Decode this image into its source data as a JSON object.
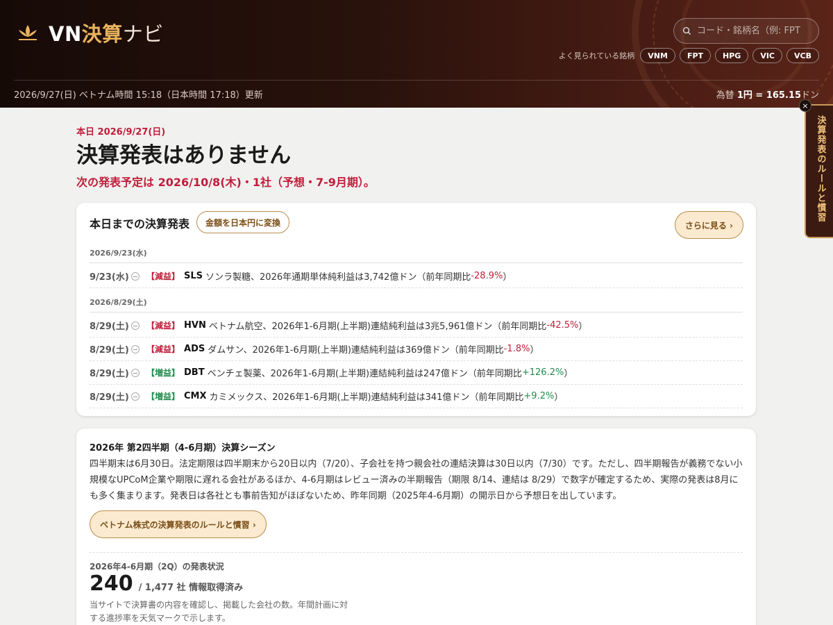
{
  "header": {
    "logo_vn": "VN",
    "logo_accent": "決算",
    "logo_kana": "ナビ",
    "search_placeholder": "コード・銘柄名（例: FPT",
    "popular_label": "よく見られている銘柄",
    "popular": [
      "VNM",
      "FPT",
      "HPG",
      "VIC",
      "VCB"
    ],
    "updated": "2026/9/27(日) ベトナム時間 15:18（日本時間 17:18）更新",
    "fx_prefix": "為替",
    "fx_value": "1円 = 165.15",
    "fx_unit": "ドン"
  },
  "sidetab": {
    "label": "決算発表のルールと慣習",
    "close": "×"
  },
  "main": {
    "today": "本日 2026/9/27(日)",
    "title": "決算発表はありません",
    "next": "次の発表予定は 2026/10/8(木)・1社（予想・7-9月期）。"
  },
  "recent": {
    "title": "本日までの決算発表",
    "convert_button": "金額を日本円に変換",
    "more_button": "さらに見る ›",
    "groups": [
      {
        "date": "2026/9/23(水)",
        "rows": [
          {
            "d": "9/23(水)",
            "tag": "【減益】",
            "code": "SLS",
            "text": "ソンラ製糖、2026年通期単体純利益は3,742億ドン（前年同期比 ",
            "change": "-28.9%",
            "close": "）"
          }
        ]
      },
      {
        "date": "2026/8/29(土)",
        "rows": [
          {
            "d": "8/29(土)",
            "tag": "【減益】",
            "code": "HVN",
            "text": "ベトナム航空、2026年1-6月期(上半期)連結純利益は3兆5,961億ドン（前年同期比 ",
            "change": "-42.5%",
            "close": "）"
          },
          {
            "d": "8/29(土)",
            "tag": "【減益】",
            "code": "ADS",
            "text": "ダムサン、2026年1-6月期(上半期)連結純利益は369億ドン（前年同期比 ",
            "change": "-1.8%",
            "close": "）"
          },
          {
            "d": "8/29(土)",
            "tag": "【増益】",
            "code": "DBT",
            "text": "ベンチェ製薬、2026年1-6月期(上半期)連結純利益は247億ドン（前年同期比 ",
            "change": "+126.2%",
            "close": "）"
          },
          {
            "d": "8/29(土)",
            "tag": "【増益】",
            "code": "CMX",
            "text": "カミメックス、2026年1-6月期(上半期)連結純利益は341億ドン（前年同期比 ",
            "change": "+9.2%",
            "close": "）"
          }
        ]
      }
    ]
  },
  "season": {
    "title": "2026年 第2四半期（4-6月期）決算シーズン",
    "body": "四半期末は6月30日。法定期限は四半期末から20日以内（7/20）、子会社を持つ親会社の連結決算は30日以内（7/30）です。ただし、四半期報告が義務でない小規模なUPCoM企業や期限に遅れる会社があるほか、4-6月期はレビュー済みの半期報告（期限 8/14、連結は 8/29）で数字が確定するため、実際の発表は8月にも多く集まります。発表日は各社とも事前告知がほぼないため、昨年同期（2025年4-6月期）の開示日から予想日を出しています。",
    "rules_button": "ベトナム株式の決算発表のルールと慣習 ›",
    "status_label": "2026年4-6月期（2Q）の発表状況",
    "count": "240",
    "total": "/ 1,477 社 情報取得済み",
    "note": "当サイトで決算書の内容を確認し、掲載した会社の数。年間計画に対する進捗率を天気マークで示します。"
  },
  "colors": {
    "negative": "#c01d3a",
    "positive": "#1f8a4a",
    "accent": "#e9b35d",
    "header_bg": "#2a120c"
  }
}
